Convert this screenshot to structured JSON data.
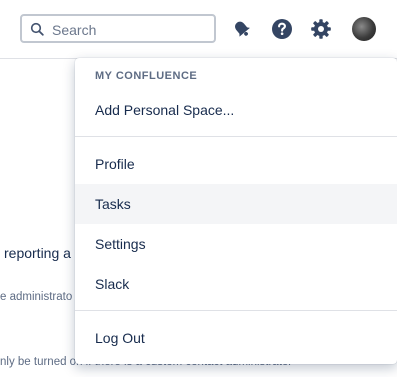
{
  "header": {
    "search_placeholder": "Search",
    "icons": [
      "search-icon",
      "bell-icon",
      "help-icon",
      "gear-icon",
      "avatar"
    ]
  },
  "background": {
    "line1": "reporting a",
    "line2": "e administrato",
    "line3": "nly be turned on if there is a custom contact administrator"
  },
  "menu": {
    "heading": "MY CONFLUENCE",
    "add_personal_space": "Add Personal Space...",
    "items": [
      "Profile",
      "Tasks",
      "Settings",
      "Slack"
    ],
    "logout": "Log Out",
    "highlighted": "Tasks"
  },
  "colors": {
    "text": "#172b4d",
    "subtle_text": "#5e6c84",
    "icon": "#344563",
    "highlight_bg": "#f4f5f7",
    "divider": "#dfe1e6"
  }
}
